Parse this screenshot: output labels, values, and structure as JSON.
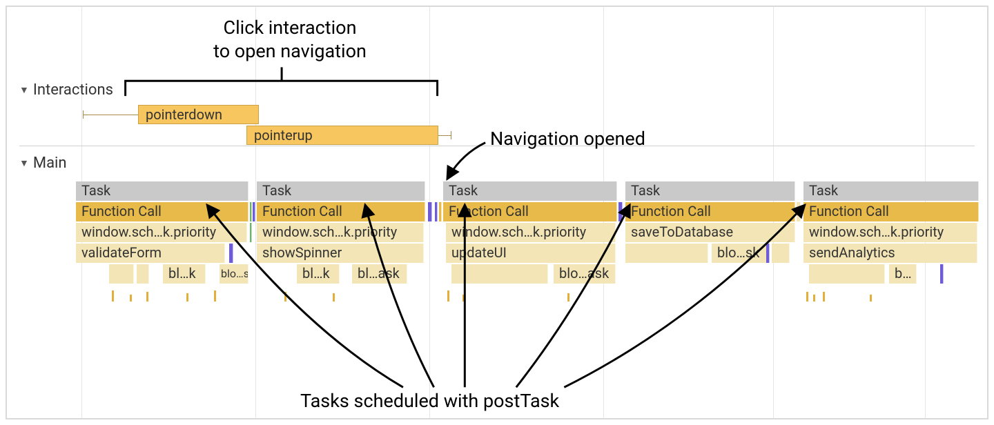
{
  "annotations": {
    "top": "Click interaction\nto open navigation",
    "nav_opened": "Navigation opened",
    "bottom": "Tasks scheduled with postTask"
  },
  "tracks": {
    "interactions_label": "Interactions",
    "main_label": "Main"
  },
  "interactions": {
    "pointerdown": "pointerdown",
    "pointerup": "pointerup"
  },
  "tasks": [
    {
      "task": "Task",
      "fn": "Function Call",
      "row3": "window.sch…k.priority",
      "row4": "validateForm",
      "row5": [
        "bl…k",
        "blo…sk"
      ]
    },
    {
      "task": "Task",
      "fn": "Function Call",
      "row3": "window.sch…k.priority",
      "row4": "showSpinner",
      "row5": [
        "bl…k",
        "bl…ask"
      ]
    },
    {
      "task": "Task",
      "fn": "Function Call",
      "row3": "window.sch…k.priority",
      "row4": "updateUI",
      "row5": [
        "blo…ask"
      ]
    },
    {
      "task": "Task",
      "fn": "Function Call",
      "row3": "saveToDatabase",
      "row4": "blo…sk",
      "row5": []
    },
    {
      "task": "Task",
      "fn": "Function Call",
      "row3": "window.sch…k.priority",
      "row4": "sendAnalytics",
      "row5": [
        "b…"
      ]
    }
  ],
  "colors": {
    "grey": "#c9c9c9",
    "gold": "#e8ba49",
    "cream": "#f3e5b5",
    "interaction": "#f7c65e"
  },
  "gridlines_x": [
    108,
    360,
    612,
    864,
    1110,
    1330
  ]
}
